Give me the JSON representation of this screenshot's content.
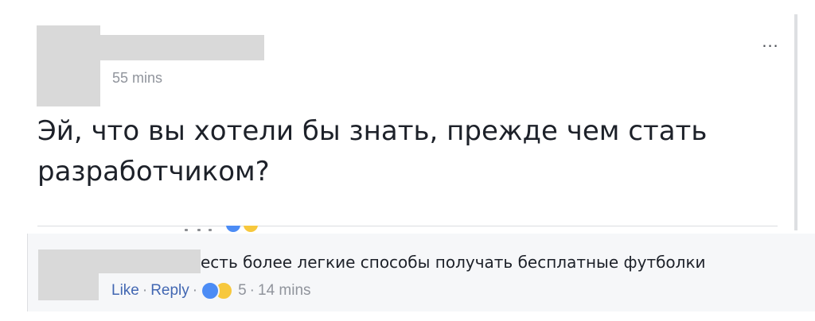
{
  "post": {
    "timestamp": "55 mins",
    "more_label": "...",
    "text": "Эй, что вы хотели бы знать, прежде чем стать разработчиком?"
  },
  "comment": {
    "text": "есть более легкие способы получать бесплатные футболки",
    "like_label": "Like",
    "reply_label": "Reply",
    "separator": "·",
    "reaction_count": "5",
    "timestamp": "14 mins",
    "reaction_icons": [
      "like-icon",
      "haha-icon"
    ]
  },
  "colors": {
    "link": "#4267b2",
    "meta": "#90949c",
    "text": "#1d2129",
    "redaction": "#d9d9d9",
    "like": "#4c8cf5",
    "haha": "#f7c83d"
  }
}
